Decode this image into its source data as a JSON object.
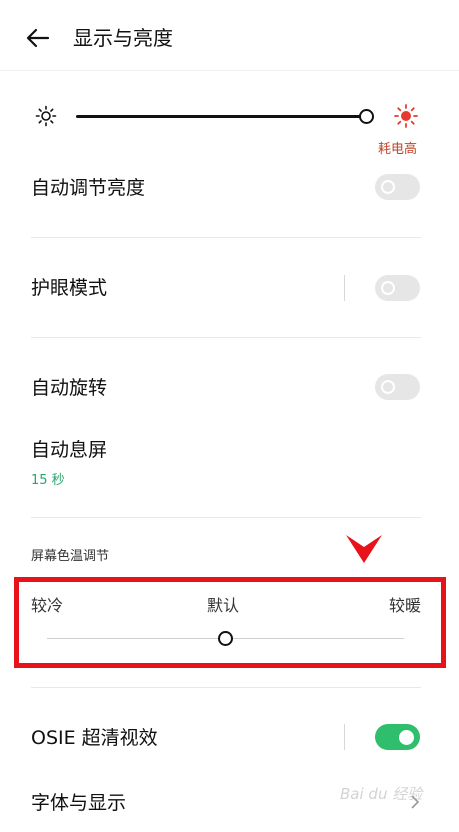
{
  "header": {
    "title": "显示与亮度"
  },
  "brightness": {
    "level": 1.0,
    "power_note": "耗电高"
  },
  "rows": {
    "auto_brightness": {
      "label": "自动调节亮度",
      "on": false
    },
    "eye_care": {
      "label": "护眼模式",
      "on": false
    },
    "auto_rotate": {
      "label": "自动旋转",
      "on": false
    },
    "screen_timeout": {
      "label": "自动息屏",
      "value": "15 秒"
    },
    "osie": {
      "label": "OSIE 超清视效",
      "on": true
    },
    "font_display": {
      "label": "字体与显示"
    }
  },
  "color_temp": {
    "section_title": "屏幕色温调节",
    "cool_label": "较冷",
    "default_label": "默认",
    "warm_label": "较暖",
    "level": 0.5
  },
  "watermark": "Bai du 经验",
  "colors": {
    "accent_green": "#2fbf6c",
    "sub_text_green": "#2aa56b",
    "warning_red": "#c0442b",
    "annotation_red": "#e8121a"
  },
  "icons": [
    "back-arrow-icon",
    "sun-low-icon",
    "sun-high-icon",
    "chevron-right-icon",
    "red-arrow-annotation"
  ]
}
